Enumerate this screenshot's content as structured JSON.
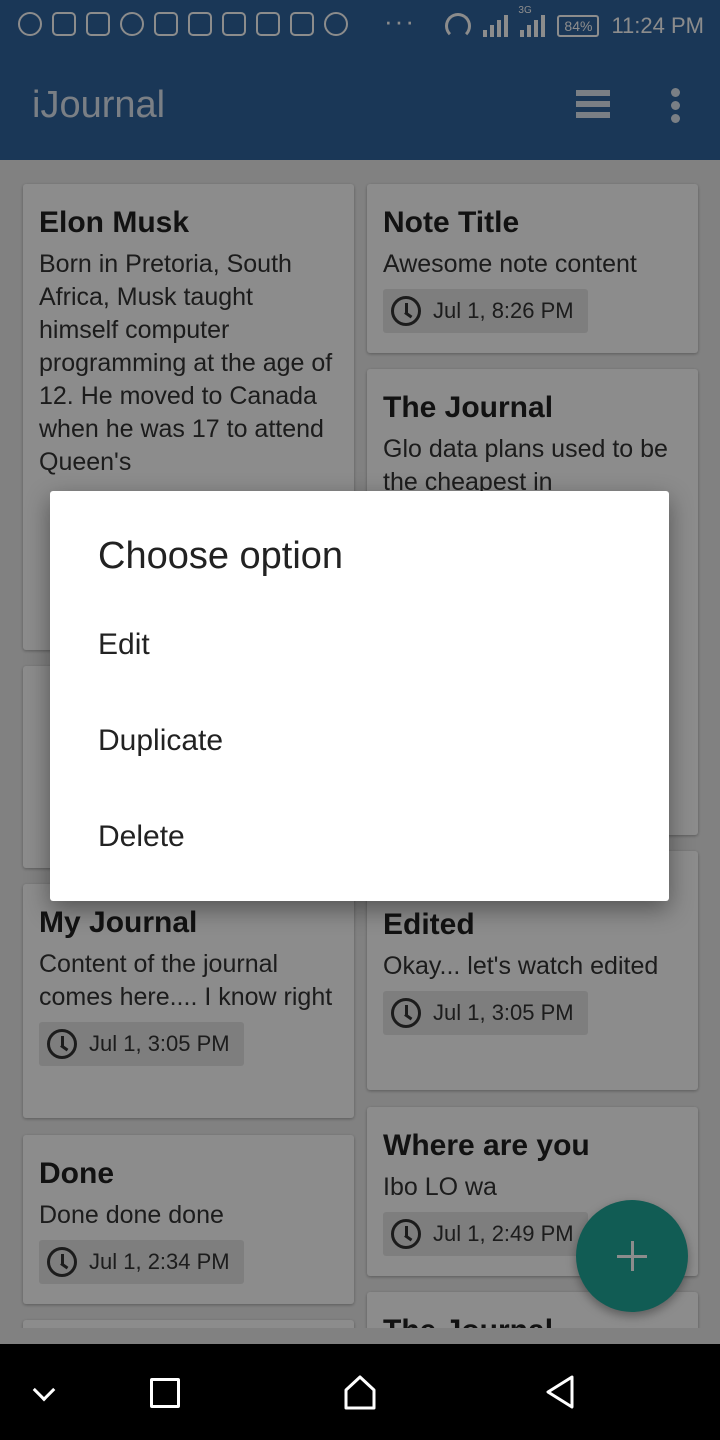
{
  "status_bar": {
    "battery": "84%",
    "time": "11:24 PM",
    "network": "3G",
    "more": "···"
  },
  "app_bar": {
    "title": "iJournal"
  },
  "cards": [
    {
      "title": "Elon Musk",
      "body": "Born in Pretoria, South Africa, Musk taught himself computer programming at the age of 12. He moved to Canada when he was 17 to attend Queen's",
      "time": ""
    },
    {
      "title": "Note Title",
      "body": "Awesome note content",
      "time": "Jul 1, 8:26 PM"
    },
    {
      "title": "The Journal",
      "body": "Glo data plans used to be the cheapest in",
      "time": ""
    },
    {
      "title": "My Journal",
      "body": "Content of the journal comes here.... I know right",
      "time": "Jul 1, 3:05 PM"
    },
    {
      "title": "Edited",
      "body": "Okay... let's watch edited",
      "time": "Jul 1, 3:05 PM"
    },
    {
      "title": "Done",
      "body": "Done done done",
      "time": "Jul 1, 2:34 PM"
    },
    {
      "title": "Where are you",
      "body": "Ibo LO wa",
      "time": "Jul 1, 2:49 PM"
    },
    {
      "title": "The Journal",
      "body": "",
      "time": ""
    }
  ],
  "dialog": {
    "title": "Choose option",
    "options": [
      "Edit",
      "Duplicate",
      "Delete"
    ]
  },
  "colors": {
    "primary": "#31659f",
    "accent": "#1fa89a"
  }
}
